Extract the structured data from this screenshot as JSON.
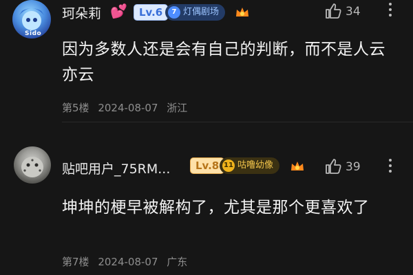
{
  "comments": [
    {
      "avatar_tag": "Sido",
      "username": "珂朵莉",
      "heart_icon": "double-heart-icon",
      "level": "Lv.6",
      "fan_badge": {
        "num": "7",
        "label": "灯偶剧场"
      },
      "likes": "34",
      "text": "因为多数人还是会有自己的判断，而不是人云亦云",
      "floor": "第5楼",
      "date": "2024-08-07",
      "location": "浙江"
    },
    {
      "username": "贴吧用户_75RM...",
      "level": "Lv.8",
      "fan_badge": {
        "num": "11",
        "label": "咕噜幼像"
      },
      "likes": "39",
      "text": "坤坤的梗早被解构了，尤其是那个更喜欢了",
      "floor": "第7楼",
      "date": "2024-08-07",
      "location": "广东"
    }
  ],
  "colors": {
    "background": "#161616",
    "level6": "#3a6fd8",
    "level8": "#b7751a",
    "heart": "#ff4f9a"
  }
}
